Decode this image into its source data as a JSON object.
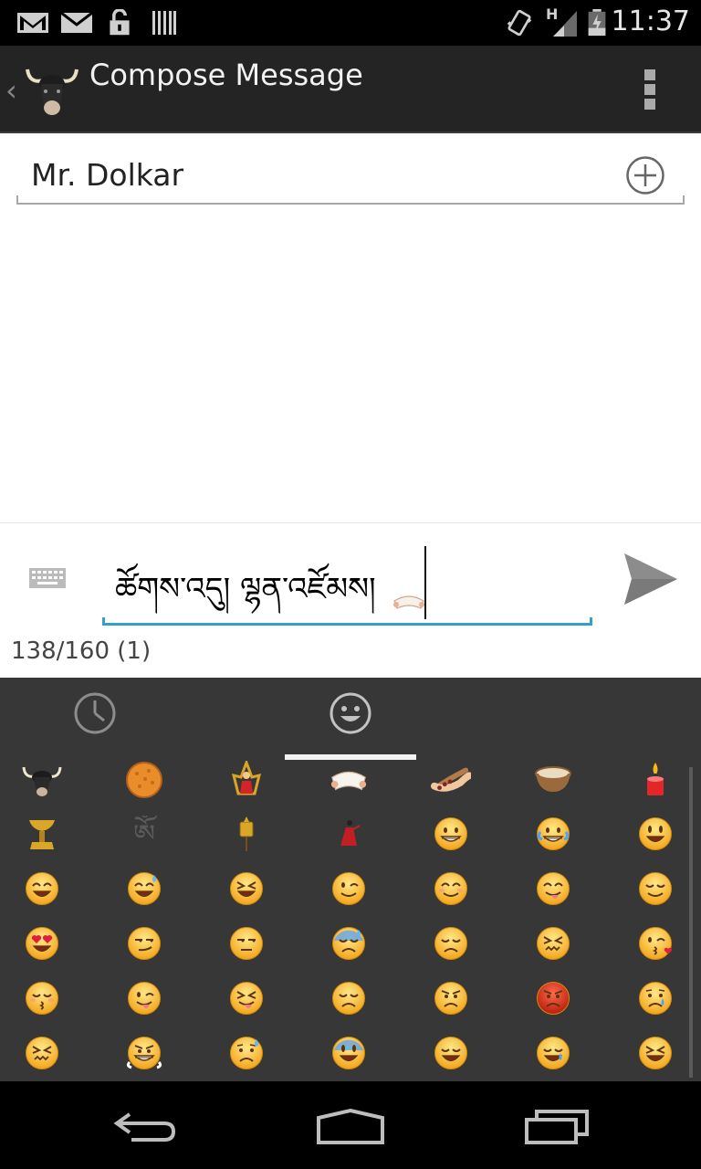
{
  "status_bar": {
    "clock": "11:37",
    "left_icons": [
      "gmail-icon",
      "email-icon",
      "unlock-icon",
      "barcode-icon"
    ],
    "right_icons": [
      "vibrate-icon",
      "signal-icon",
      "battery-icon"
    ],
    "network_label": "H"
  },
  "action_bar": {
    "title": "Compose Message",
    "logo": "yak-logo-icon"
  },
  "compose": {
    "recipient": "Mr. Dolkar",
    "message": "ཚོགས་འདུ། ལྷན་འཛོམས།",
    "counter": "138/160 (1)"
  },
  "emoji_keyboard": {
    "tabs": [
      "recent-icon",
      "smiley-icon"
    ],
    "active_tab": 1,
    "rows": [
      [
        "yak-icon",
        "tsampa-bread-icon",
        "deity-figure-icon",
        "khata-scarf-icon",
        "prayer-beads-icon",
        "butter-tea-bowl-icon",
        "butter-lamp-icon"
      ],
      [
        "golden-lamp-icon",
        "om-symbol-icon",
        "prayer-wheel-icon",
        "dancer-icon",
        "😁",
        "😂",
        "😃"
      ],
      [
        "😄",
        "😅",
        "😆",
        "😉",
        "😊",
        "😋",
        "😌"
      ],
      [
        "😍",
        "😏",
        "😒",
        "😓",
        "😔",
        "😖",
        "😘"
      ],
      [
        "😚",
        "😜",
        "😝",
        "😞",
        "😠",
        "😡",
        "😢"
      ],
      [
        "😣",
        "😤",
        "😥",
        "😨",
        "😩",
        "😪",
        "😫"
      ]
    ]
  },
  "colors": {
    "accent": "#33a0c8",
    "action_bar": "#242424",
    "keyboard_bg": "#373737"
  }
}
